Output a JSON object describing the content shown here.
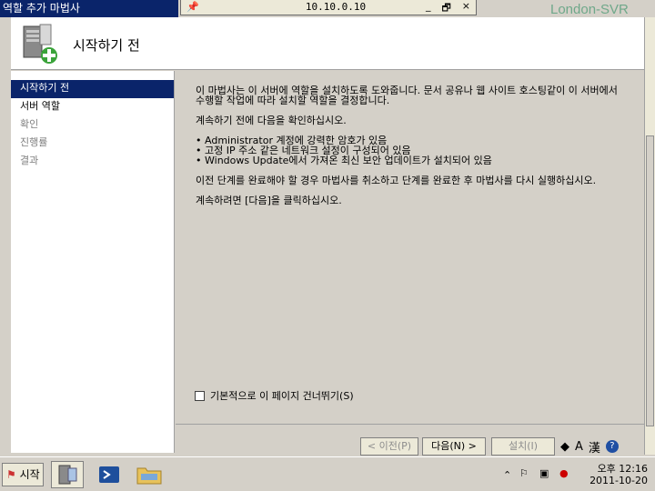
{
  "window": {
    "title": "역할 추가 마법사",
    "remote_host": "10.10.0.10",
    "watermark": "London-SVR"
  },
  "rdp_controls": {
    "minimize": "_",
    "restore": "🗗",
    "close": "×"
  },
  "header": {
    "title": "시작하기 전"
  },
  "sidebar": {
    "items": [
      {
        "label": "시작하기 전",
        "state": "active"
      },
      {
        "label": "서버 역할",
        "state": "normal"
      },
      {
        "label": "확인",
        "state": "dim"
      },
      {
        "label": "진행률",
        "state": "dim"
      },
      {
        "label": "결과",
        "state": "dim"
      }
    ]
  },
  "content": {
    "intro": "이 마법사는 이 서버에 역할을 설치하도록 도와줍니다. 문서 공유나 웹 사이트 호스팅같이 이 서버에서 수행할 작업에 따라 설치할 역할을 결정합니다.",
    "confirm": "계속하기 전에 다음을 확인하십시오.",
    "checks": [
      "Administrator 계정에 강력한 암호가 있음",
      "고정 IP 주소 같은 네트워크 설정이 구성되어 있음",
      "Windows Update에서 가져온 최신 보안 업데이트가 설치되어 있음"
    ],
    "cancel_note": "이전 단계를 완료해야 할 경우 마법사를 취소하고 단계를 완료한 후 마법사를 다시 실행하십시오.",
    "next_note": "계속하려면 [다음]을 클릭하십시오."
  },
  "skip_checkbox": {
    "label": "기본적으로 이 페이지 건너뛰기(S)",
    "checked": false
  },
  "buttons": {
    "prev": "< 이전(P)",
    "next": "다음(N) >",
    "install": "설치(I)"
  },
  "langbar": {
    "a": "A",
    "han": "漢",
    "help": "?"
  },
  "taskbar": {
    "start": "시작",
    "clock_time": "오후 12:16",
    "clock_date": "2011-10-20"
  },
  "colors": {
    "selection": "#0a246a",
    "face": "#d4d0c8"
  }
}
